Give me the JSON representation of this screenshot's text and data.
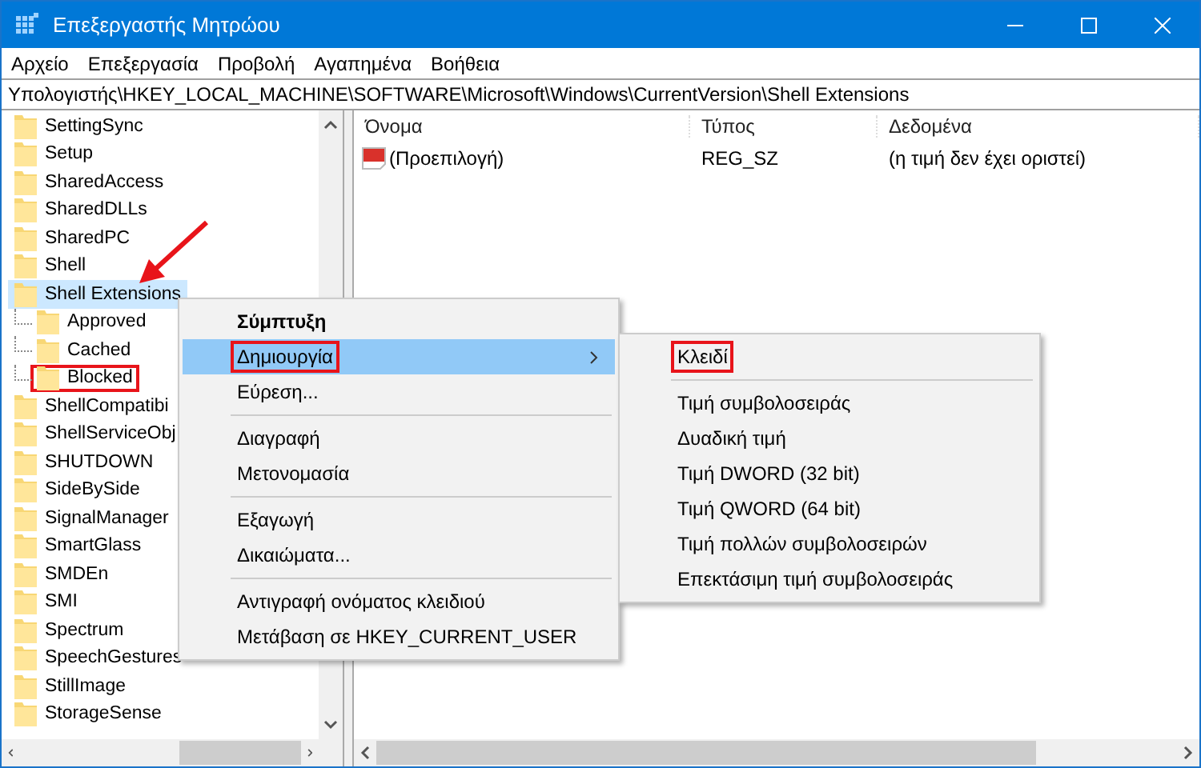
{
  "window": {
    "title": "Επεξεργαστής Μητρώου"
  },
  "menu_bar": [
    "Αρχείο",
    "Επεξεργασία",
    "Προβολή",
    "Αγαπημένα",
    "Βοήθεια"
  ],
  "address_bar": {
    "value": "Υπολογιστής\\HKEY_LOCAL_MACHINE\\SOFTWARE\\Microsoft\\Windows\\CurrentVersion\\Shell Extensions"
  },
  "tree": [
    {
      "label": "SettingSync",
      "selected": false,
      "annotated": false
    },
    {
      "label": "Setup",
      "selected": false,
      "annotated": false
    },
    {
      "label": "SharedAccess",
      "selected": false,
      "annotated": false
    },
    {
      "label": "SharedDLLs",
      "selected": false,
      "annotated": false
    },
    {
      "label": "SharedPC",
      "selected": false,
      "annotated": false
    },
    {
      "label": "Shell",
      "selected": false,
      "annotated": false
    },
    {
      "label": "Shell Extensions",
      "selected": true,
      "annotated": false,
      "children": [
        {
          "label": "Approved",
          "selected": false,
          "annotated": false
        },
        {
          "label": "Cached",
          "selected": false,
          "annotated": false
        },
        {
          "label": "Blocked",
          "selected": false,
          "annotated": true
        }
      ]
    },
    {
      "label": "ShellCompatibi",
      "selected": false,
      "annotated": false
    },
    {
      "label": "ShellServiceObj",
      "selected": false,
      "annotated": false
    },
    {
      "label": "SHUTDOWN",
      "selected": false,
      "annotated": false
    },
    {
      "label": "SideBySide",
      "selected": false,
      "annotated": false
    },
    {
      "label": "SignalManager",
      "selected": false,
      "annotated": false
    },
    {
      "label": "SmartGlass",
      "selected": false,
      "annotated": false
    },
    {
      "label": "SMDEn",
      "selected": false,
      "annotated": false
    },
    {
      "label": "SMI",
      "selected": false,
      "annotated": false
    },
    {
      "label": "Spectrum",
      "selected": false,
      "annotated": false
    },
    {
      "label": "SpeechGestures",
      "selected": false,
      "annotated": false
    },
    {
      "label": "StillImage",
      "selected": false,
      "annotated": false
    },
    {
      "label": "StorageSense",
      "selected": false,
      "annotated": false
    }
  ],
  "values_table": {
    "columns": [
      "Όνομα",
      "Τύπος",
      "Δεδομένα"
    ],
    "rows": [
      {
        "name": "(Προεπιλογή)",
        "type": "REG_SZ",
        "data": "(η τιμή δεν έχει οριστεί)"
      }
    ]
  },
  "context_menu": [
    {
      "kind": "item",
      "label": "Σύμπτυξη",
      "bold": true,
      "selected": false,
      "submenu": false,
      "annotated": false
    },
    {
      "kind": "item",
      "label": "Δημιουργία",
      "bold": false,
      "selected": true,
      "submenu": true,
      "annotated": true
    },
    {
      "kind": "item",
      "label": "Εύρεση...",
      "bold": false,
      "selected": false,
      "submenu": false,
      "annotated": false
    },
    {
      "kind": "separator"
    },
    {
      "kind": "item",
      "label": "Διαγραφή",
      "bold": false,
      "selected": false,
      "submenu": false,
      "annotated": false
    },
    {
      "kind": "item",
      "label": "Μετονομασία",
      "bold": false,
      "selected": false,
      "submenu": false,
      "annotated": false
    },
    {
      "kind": "separator"
    },
    {
      "kind": "item",
      "label": "Εξαγωγή",
      "bold": false,
      "selected": false,
      "submenu": false,
      "annotated": false
    },
    {
      "kind": "item",
      "label": "Δικαιώματα...",
      "bold": false,
      "selected": false,
      "submenu": false,
      "annotated": false
    },
    {
      "kind": "separator"
    },
    {
      "kind": "item",
      "label": "Αντιγραφή ονόματος κλειδιού",
      "bold": false,
      "selected": false,
      "submenu": false,
      "annotated": false
    },
    {
      "kind": "item",
      "label": "Μετάβαση σε HKEY_CURRENT_USER",
      "bold": false,
      "selected": false,
      "submenu": false,
      "annotated": false
    }
  ],
  "submenu": [
    {
      "kind": "item",
      "label": "Κλειδί",
      "bold": false,
      "selected": false,
      "submenu": false,
      "annotated": true
    },
    {
      "kind": "separator"
    },
    {
      "kind": "item",
      "label": "Τιμή συμβολοσειράς",
      "bold": false,
      "selected": false,
      "submenu": false,
      "annotated": false
    },
    {
      "kind": "item",
      "label": "Δυαδική τιμή",
      "bold": false,
      "selected": false,
      "submenu": false,
      "annotated": false
    },
    {
      "kind": "item",
      "label": "Τιμή DWORD (32 bit)",
      "bold": false,
      "selected": false,
      "submenu": false,
      "annotated": false
    },
    {
      "kind": "item",
      "label": "Τιμή QWORD (64 bit)",
      "bold": false,
      "selected": false,
      "submenu": false,
      "annotated": false
    },
    {
      "kind": "item",
      "label": "Τιμή πολλών συμβολοσειρών",
      "bold": false,
      "selected": false,
      "submenu": false,
      "annotated": false
    },
    {
      "kind": "item",
      "label": "Επεκτάσιμη τιμή συμβολοσειράς",
      "bold": false,
      "selected": false,
      "submenu": false,
      "annotated": false
    }
  ]
}
